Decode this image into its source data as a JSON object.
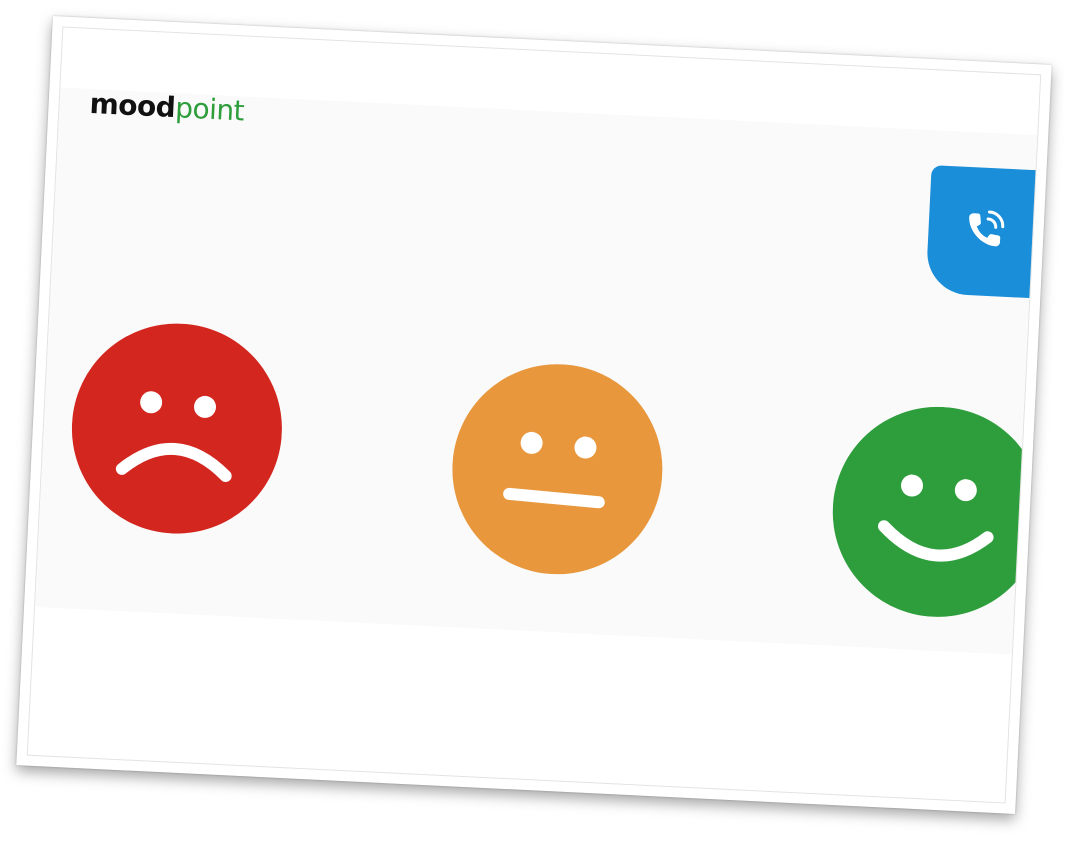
{
  "brand": {
    "logo_text_part1": "mood",
    "logo_text_part2": "point",
    "primary_color": "#2e9e3c",
    "dark_color": "#111111"
  },
  "call_button": {
    "icon": "phone-ringing-icon",
    "color": "#1a8ed8"
  },
  "moods": [
    {
      "name": "sad",
      "icon": "sad-face-icon",
      "color": "#d3261f"
    },
    {
      "name": "neutral",
      "icon": "neutral-face-icon",
      "color": "#e8973c"
    },
    {
      "name": "happy",
      "icon": "happy-face-icon",
      "color": "#2e9e3c"
    }
  ]
}
